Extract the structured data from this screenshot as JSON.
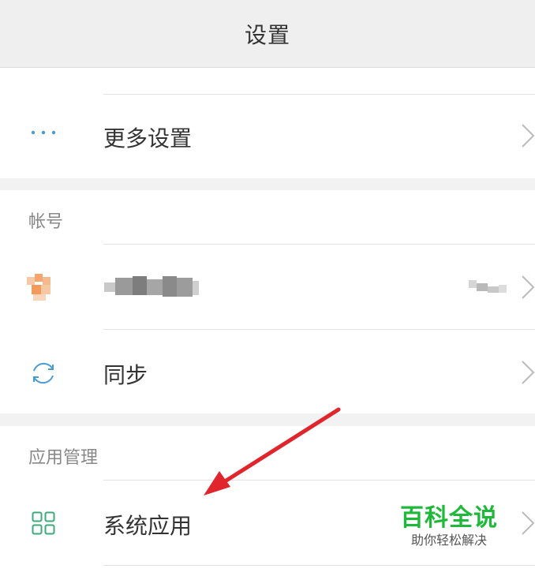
{
  "header": {
    "title": "设置"
  },
  "sections": {
    "more": {
      "label": "更多设置",
      "icon": "more-dots-icon"
    },
    "account": {
      "title": "帐号",
      "sync_label": "同步",
      "sync_icon": "sync-icon"
    },
    "apps": {
      "title": "应用管理",
      "system_apps_label": "系统应用",
      "system_apps_icon": "grid-apps-icon"
    }
  },
  "watermark": {
    "main": "百科全说",
    "sub": "助你轻松解决"
  },
  "colors": {
    "accent_icon": "#4a9bd1",
    "grid_icon": "#3daa7a",
    "arrow": "#e0262c",
    "watermark_green": "#1fb93a",
    "background": "#f2f2f2"
  }
}
